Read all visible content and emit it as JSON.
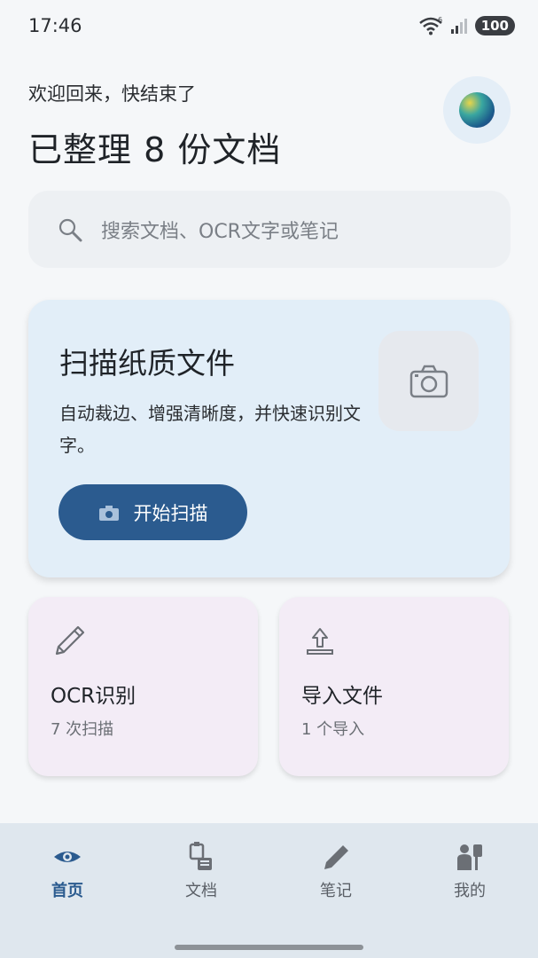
{
  "status_bar": {
    "time": "17:46",
    "battery": "100",
    "signal_label": "6"
  },
  "header": {
    "greeting": "欢迎回来，快结束了",
    "headline": "已整理 8 份文档"
  },
  "search": {
    "placeholder": "搜索文档、OCR文字或笔记"
  },
  "scan_card": {
    "title": "扫描纸质文件",
    "description": "自动裁边、增强清晰度，并快速识别文字。",
    "button_label": "开始扫描"
  },
  "cards": [
    {
      "title": "OCR识别",
      "subtitle": "7 次扫描",
      "icon": "pencil-icon"
    },
    {
      "title": "导入文件",
      "subtitle": "1 个导入",
      "icon": "upload-icon"
    }
  ],
  "bottom_nav": [
    {
      "label": "首页",
      "icon": "eye-icon",
      "active": true
    },
    {
      "label": "文档",
      "icon": "document-stack-icon",
      "active": false
    },
    {
      "label": "笔记",
      "icon": "pencil-icon",
      "active": false
    },
    {
      "label": "我的",
      "icon": "person-icon",
      "active": false
    }
  ],
  "colors": {
    "accent": "#2b5b8f",
    "background": "#f5f7f9",
    "scan_card": "#e2eef8",
    "mini_card": "#f3ecf6",
    "nav_bar": "#dfe7ee"
  }
}
